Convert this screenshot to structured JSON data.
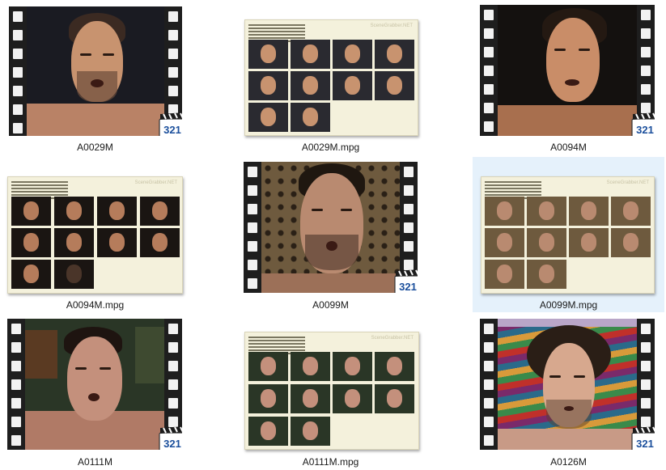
{
  "items": [
    {
      "label": "A0029M",
      "kind": "video"
    },
    {
      "label": "A0029M.mpg",
      "kind": "sheet"
    },
    {
      "label": "A0094M",
      "kind": "video"
    },
    {
      "label": "A0094M.mpg",
      "kind": "sheet"
    },
    {
      "label": "A0099M",
      "kind": "video"
    },
    {
      "label": "A0099M.mpg",
      "kind": "sheet",
      "selected": true
    },
    {
      "label": "A0111M",
      "kind": "video"
    },
    {
      "label": "A0111M.mpg",
      "kind": "sheet"
    },
    {
      "label": "A0126M",
      "kind": "video"
    }
  ],
  "sheet_brand": "SceneGrabber.NET",
  "icon": "media-player-classic-321-icon",
  "colors": {
    "selection": "#e5f1fb",
    "sheet_background": "#f4f1dc",
    "film": "#141414"
  }
}
